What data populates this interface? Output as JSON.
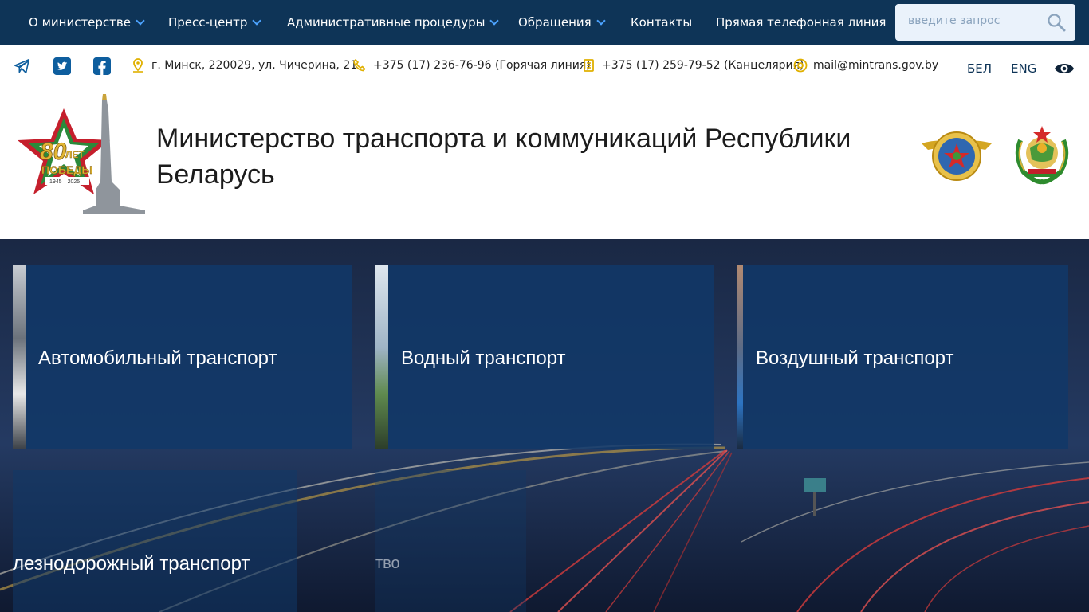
{
  "nav": {
    "items": [
      {
        "label": "О министерстве",
        "dropdown": true
      },
      {
        "label": "Пресс-центр",
        "dropdown": true
      },
      {
        "label": "Административные процедуры",
        "dropdown": true
      },
      {
        "label": "Обращения",
        "dropdown": true
      },
      {
        "label": "Контакты",
        "dropdown": false
      },
      {
        "label": "Прямая телефонная линия",
        "dropdown": false
      }
    ],
    "search_placeholder": "введите запрос"
  },
  "infobar": {
    "social": [
      "telegram-icon",
      "twitter-icon",
      "facebook-icon"
    ],
    "address": "г. Минск, 220029, ул. Чичерина, 21",
    "hotline": "+375 (17) 236-76-96 (Горячая линия)",
    "office": "+375 (17) 259-79-52 (Канцелярия)",
    "email": "mail@mintrans.gov.by",
    "lang_be": "БЕЛ",
    "lang_en": "ENG"
  },
  "header": {
    "title": "Министерство транспорта и коммуникаций Республики Беларусь",
    "victory_logo": {
      "big": "80",
      "word1": "ЛЕТ",
      "word2": "ПОБЕДЫ",
      "years": "1945—2025"
    }
  },
  "tiles": [
    {
      "label": "Автомобильный транспорт"
    },
    {
      "label": "Водный транспорт"
    },
    {
      "label": "Воздушный транспорт"
    },
    {
      "label": "лезнодорожный транспорт"
    },
    {
      "label": "тво"
    }
  ],
  "colors": {
    "nav_bg": "#0e3457",
    "accent_blue": "#4da3ff",
    "icon_gold": "#e0b000",
    "tile_bg": "#113868"
  }
}
